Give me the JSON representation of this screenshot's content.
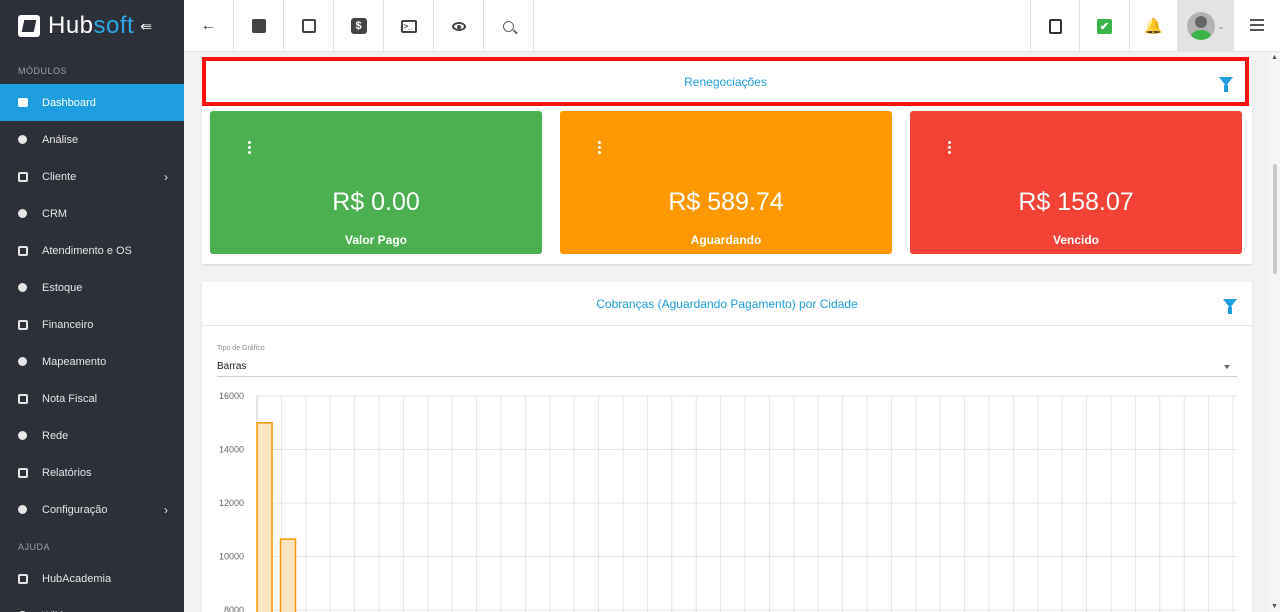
{
  "brand": {
    "name_part1": "Hub",
    "name_part2": "soft",
    "collapse_glyph": "⇚"
  },
  "sidebar": {
    "section_modules": "MÓDULOS",
    "items": [
      {
        "label": "Dashboard",
        "icon": "dashboard-icon",
        "active": true
      },
      {
        "label": "Análise",
        "icon": "pie-chart-icon"
      },
      {
        "label": "Cliente",
        "icon": "contact-card-icon",
        "chevron": true
      },
      {
        "label": "CRM",
        "icon": "trello-board-icon"
      },
      {
        "label": "Atendimento e OS",
        "icon": "calendar-clock-icon"
      },
      {
        "label": "Estoque",
        "icon": "cube-icon"
      },
      {
        "label": "Financeiro",
        "icon": "money-icon"
      },
      {
        "label": "Mapeamento",
        "icon": "map-pin-icon"
      },
      {
        "label": "Nota Fiscal",
        "icon": "receipt-icon"
      },
      {
        "label": "Rede",
        "icon": "network-icon"
      },
      {
        "label": "Relatórios",
        "icon": "report-icon"
      },
      {
        "label": "Configuração",
        "icon": "gear-icon",
        "chevron": true
      }
    ],
    "section_help": "AJUDA",
    "help_items": [
      {
        "label": "HubAcademia",
        "icon": "play-icon"
      },
      {
        "label": "Wiki",
        "icon": "wiki-icon"
      }
    ]
  },
  "topbar": {
    "back_glyph": "←",
    "dollar_glyph": "$",
    "terminal_glyph": ">_",
    "check_glyph": "✔",
    "bell_glyph": "🔔",
    "avatar_chevron": "⌄"
  },
  "renegociacoes": {
    "title": "Renegociações",
    "cards": [
      {
        "amount": "R$ 0.00",
        "label": "Valor Pago",
        "color": "#4caf50"
      },
      {
        "amount": "R$ 589.74",
        "label": "Aguardando",
        "color": "#ff9800"
      },
      {
        "amount": "R$ 158.07",
        "label": "Vencido",
        "color": "#f44336"
      }
    ]
  },
  "cobrancas": {
    "title": "Cobranças (Aguardando Pagamento) por Cidade",
    "chart_type_label": "Tipo de Gráfico",
    "chart_type_value": "Barras"
  },
  "chart_data": {
    "type": "bar",
    "title": "Cobranças (Aguardando Pagamento) por Cidade",
    "values": [
      15000,
      10650
    ],
    "y_ticks": [
      "16000",
      "14000",
      "12000",
      "10000",
      "8000"
    ],
    "ylim_visible": [
      8000,
      16000
    ],
    "bar_color": "#ff9800",
    "bar_fill": "#fde5c4",
    "grid": true
  }
}
